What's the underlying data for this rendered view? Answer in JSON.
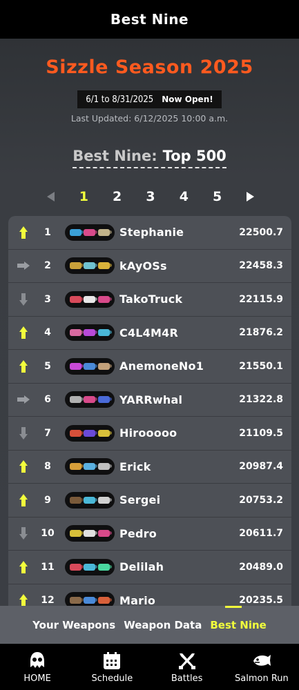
{
  "header": {
    "title": "Best Nine"
  },
  "season": {
    "title": "Sizzle Season 2025",
    "dates": "6/1 to 8/31/2025",
    "status": "Now Open!",
    "updated": "Last Updated: 6/12/2025 10:00 a.m."
  },
  "section": {
    "label": "Best Nine:",
    "value": "Top 500"
  },
  "pager": {
    "pages": [
      "1",
      "2",
      "3",
      "4",
      "5"
    ],
    "active": "1",
    "prev_icon": "left-arrow-icon",
    "next_icon": "right-arrow-icon"
  },
  "rankings": [
    {
      "trend": "up",
      "rank": "1",
      "name": "Stephanie",
      "power": "22500.7",
      "weapons": [
        "#3aa0d8",
        "#d84a8a",
        "#c2b38a"
      ]
    },
    {
      "trend": "same",
      "rank": "2",
      "name": "kAyOSs",
      "power": "22458.3",
      "weapons": [
        "#c9a13a",
        "#6fc2d0",
        "#d8b23a"
      ]
    },
    {
      "trend": "down",
      "rank": "3",
      "name": "TakoTruck",
      "power": "22115.9",
      "weapons": [
        "#d84a5a",
        "#e8e8e8",
        "#d84a8a"
      ]
    },
    {
      "trend": "up",
      "rank": "4",
      "name": "C4L4M4R",
      "power": "21876.2",
      "weapons": [
        "#d86aa0",
        "#b84ad8",
        "#4ab8d8"
      ]
    },
    {
      "trend": "up",
      "rank": "5",
      "name": "AnemoneNo1",
      "power": "21550.1",
      "weapons": [
        "#c94ad8",
        "#4a8ad8",
        "#c2a07a"
      ]
    },
    {
      "trend": "same",
      "rank": "6",
      "name": "YARRwhal",
      "power": "21322.8",
      "weapons": [
        "#b0b0b0",
        "#d84a8a",
        "#4a6ad8"
      ]
    },
    {
      "trend": "down",
      "rank": "7",
      "name": "Hirooooo",
      "power": "21109.5",
      "weapons": [
        "#d8503a",
        "#6a4ad8",
        "#d8c03a"
      ]
    },
    {
      "trend": "up",
      "rank": "8",
      "name": "Erick",
      "power": "20987.4",
      "weapons": [
        "#d8a03a",
        "#5ab0e0",
        "#c0c0c0"
      ]
    },
    {
      "trend": "up",
      "rank": "9",
      "name": "Sergei",
      "power": "20753.2",
      "weapons": [
        "#7a5a3a",
        "#4ab8d8",
        "#d0d0d0"
      ]
    },
    {
      "trend": "down",
      "rank": "10",
      "name": "Pedro",
      "power": "20611.7",
      "weapons": [
        "#d8c03a",
        "#e0e0e0",
        "#d84a8a"
      ]
    },
    {
      "trend": "up",
      "rank": "11",
      "name": "Delilah",
      "power": "20489.0",
      "weapons": [
        "#d84a5a",
        "#4ab8d8",
        "#4ad8a0"
      ]
    },
    {
      "trend": "up",
      "rank": "12",
      "name": "Mario",
      "power": "20235.5",
      "weapons": [
        "#8a6a4a",
        "#4a8ad8",
        "#d8603a"
      ]
    }
  ],
  "subtabs": [
    {
      "label": "Your Weapons",
      "active": false
    },
    {
      "label": "Weapon Data",
      "active": false
    },
    {
      "label": "Best Nine",
      "active": true
    }
  ],
  "bottomnav": [
    {
      "label": "HOME",
      "icon": "squid-icon"
    },
    {
      "label": "Schedule",
      "icon": "calendar-icon"
    },
    {
      "label": "Battles",
      "icon": "crossed-weapons-icon"
    },
    {
      "label": "Salmon Run",
      "icon": "salmon-icon"
    }
  ],
  "colors": {
    "accent": "#f2ff3c",
    "season_title": "#ff5a1f",
    "background": "#3b3e44"
  }
}
